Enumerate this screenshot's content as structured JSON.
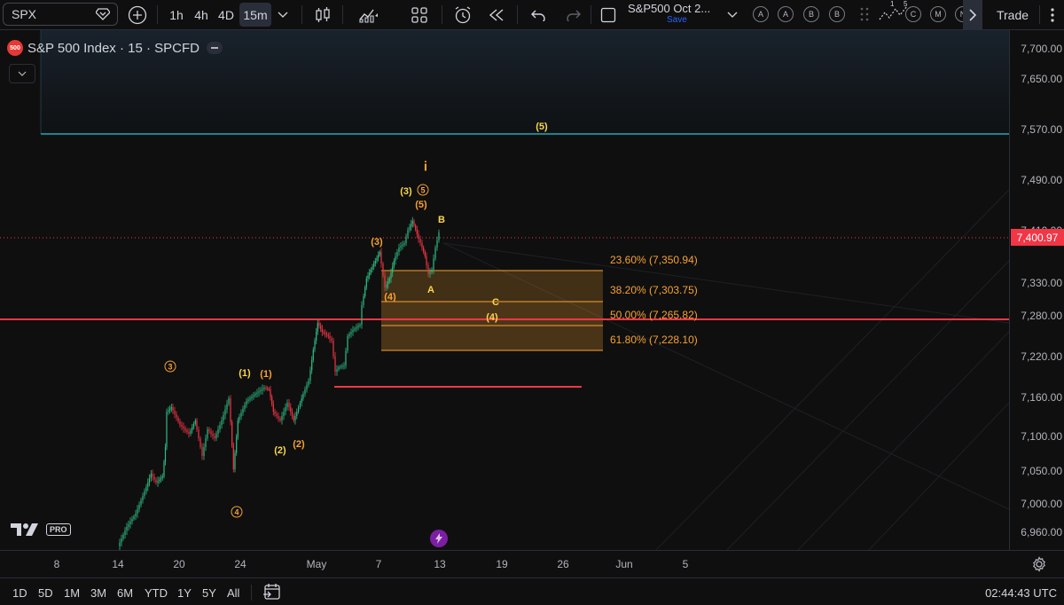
{
  "toolbar": {
    "symbol": "SPX",
    "intervals": [
      "1h",
      "4h",
      "4D",
      "15m"
    ],
    "layout_name": "S&P500 Oct 2...",
    "save_label": "Save",
    "trade_label": "Trade",
    "alert_letters": [
      "A",
      "A",
      "B",
      "B"
    ],
    "compare_letters": [
      "C",
      "M",
      "N"
    ],
    "mini_labels": [
      "1",
      "5"
    ]
  },
  "legend": {
    "badge": "500",
    "title": "S&P 500 Index · 15 · SPCFD"
  },
  "watermark": {
    "pro": "PRO"
  },
  "price_axis": {
    "labels": [
      "7,700.00",
      "7,650.00",
      "7,570.00",
      "7,490.00",
      "7,410.00",
      "7,330.00",
      "7,280.00",
      "7,220.00",
      "7,160.00",
      "7,100.00",
      "7,050.00",
      "7,000.00",
      "6,960.00"
    ],
    "current_price": "7,400.97",
    "current_color": "#f23645"
  },
  "time_axis": {
    "labels": [
      "8",
      "14",
      "20",
      "24",
      "May",
      "7",
      "13",
      "19",
      "26",
      "Jun",
      "5"
    ]
  },
  "bottom_bar": {
    "ranges": [
      "1D",
      "5D",
      "1M",
      "3M",
      "6M",
      "YTD",
      "1Y",
      "5Y",
      "All"
    ],
    "clock": "02:44:43 UTC"
  },
  "fib_levels": [
    {
      "label": "23.60% (7,350.94)"
    },
    {
      "label": "38.20% (7,303.75)"
    },
    {
      "label": "50.00% (7,265.82)"
    },
    {
      "label": "61.80% (7,228.10)"
    }
  ],
  "wave_labels": {
    "top5": "(5)",
    "i": "i",
    "w3a": "(3)",
    "w5c": "5",
    "w5b": "(5)",
    "B": "B",
    "w3b": "(3)",
    "A": "A",
    "w4": "(4)",
    "C": "C",
    "w4b": "(4)",
    "c3": "3",
    "w1a": "(1)",
    "w1b": "(1)",
    "w2a": "(2)",
    "w2b": "(2)",
    "c4": "4"
  },
  "colors": {
    "accent": "#f7a233",
    "yellow": "#f9d84a",
    "red_line": "#f23645",
    "cyan_line": "#26c6da",
    "zone_fill": "#f7a233"
  }
}
